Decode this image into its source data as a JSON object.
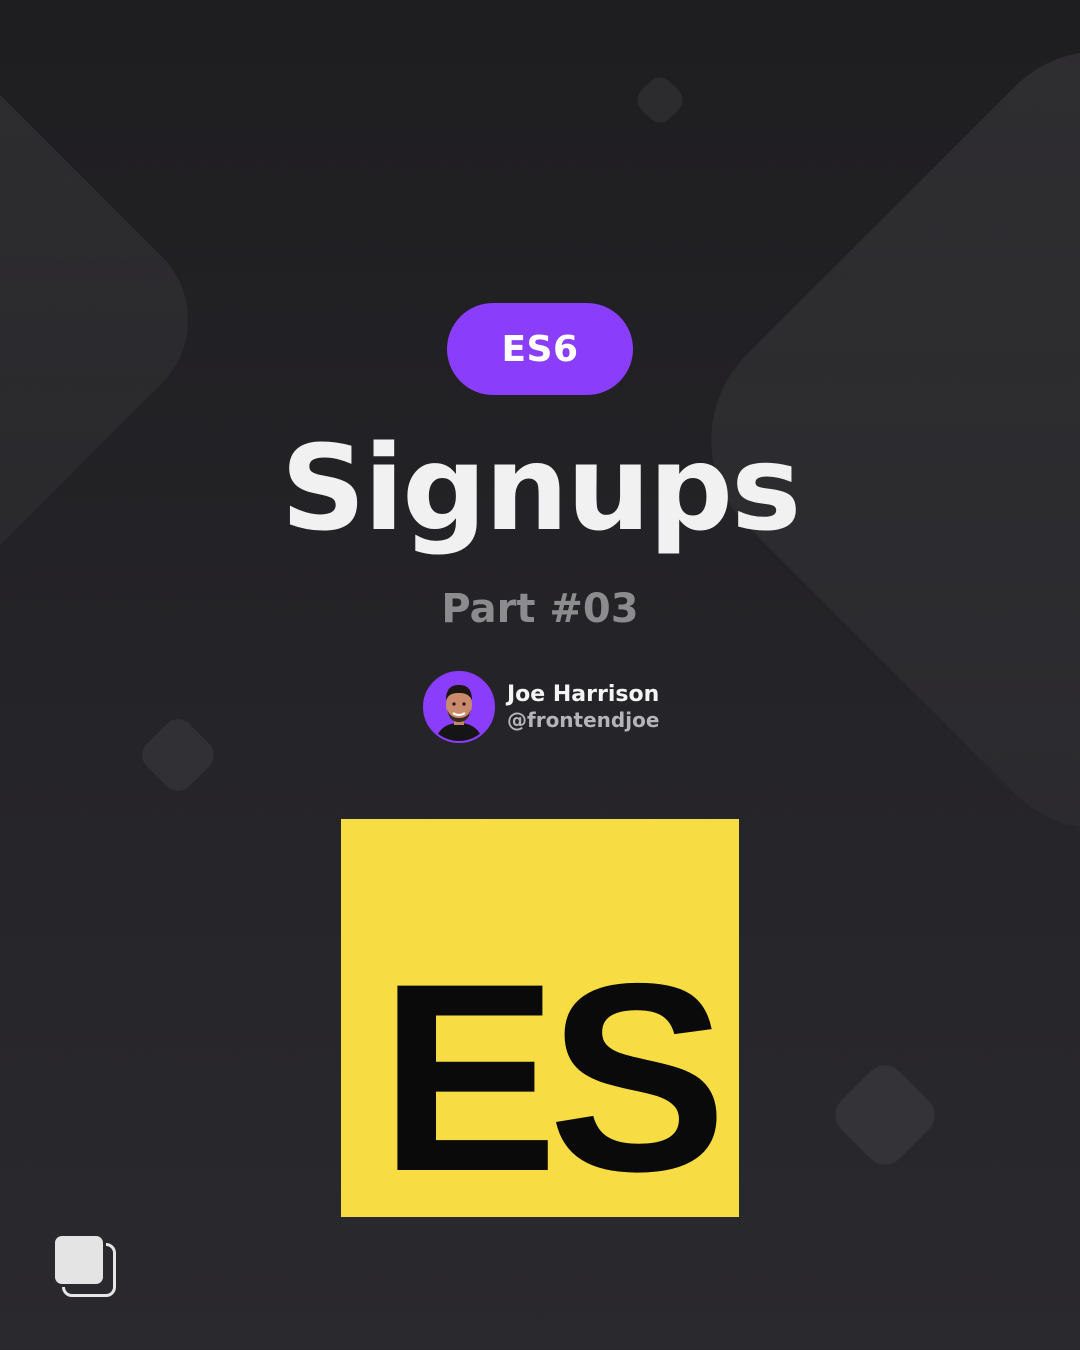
{
  "post": {
    "tag": "ES6",
    "title": "Signups",
    "subtitle": "Part #03"
  },
  "author": {
    "name": "Joe Harrison",
    "handle": "@frontendjoe"
  },
  "logo": {
    "text": "ES",
    "background_color": "#f7dd43",
    "text_color": "#0a0a0a"
  },
  "colors": {
    "accent": "#8a3dfa",
    "background": "#232226",
    "title": "#f1f1f1",
    "subtitle": "#8c8b8e"
  },
  "icons": {
    "carousel": "multiple-images-icon"
  }
}
